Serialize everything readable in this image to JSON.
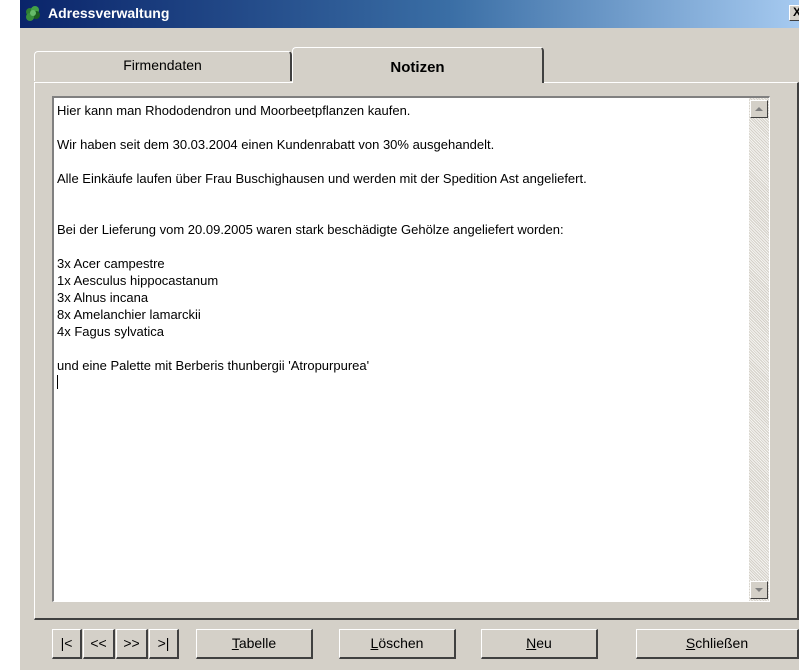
{
  "window": {
    "title": "Adressverwaltung",
    "close_glyph": "X",
    "icon": "app-tree-icon"
  },
  "tabs": [
    {
      "label": "Firmendaten",
      "active": false
    },
    {
      "label": "Notizen",
      "active": true
    }
  ],
  "notes": {
    "lines": [
      "Hier kann man Rhododendron und Moorbeetpflanzen kaufen.",
      "",
      "Wir haben seit dem 30.03.2004 einen Kundenrabatt von 30% ausgehandelt.",
      "",
      "Alle Einkäufe laufen über Frau Buschighausen und werden mit der Spedition Ast angeliefert.",
      "",
      "",
      "Bei der Lieferung vom 20.09.2005 waren stark beschädigte Gehölze angeliefert worden:",
      "",
      "3x Acer campestre",
      "1x Aesculus hippocastanum",
      "3x Alnus incana",
      "8x Amelanchier lamarckii",
      "4x Fagus sylvatica",
      "",
      "und eine Palette mit Berberis thunbergii 'Atropurpurea'"
    ]
  },
  "nav_buttons": {
    "first": "|<",
    "prev": "<<",
    "next": ">>",
    "last": ">|"
  },
  "buttons": {
    "tabelle": {
      "mnemonic": "T",
      "rest": "abelle"
    },
    "loeschen": {
      "mnemonic": "L",
      "rest": "öschen"
    },
    "neu": {
      "mnemonic": "N",
      "rest": "eu"
    },
    "schliessen": {
      "mnemonic": "S",
      "rest": "chließen"
    }
  },
  "colors": {
    "titlebar_start": "#0a246a",
    "titlebar_end": "#a6caf0",
    "face": "#d4d0c8"
  }
}
